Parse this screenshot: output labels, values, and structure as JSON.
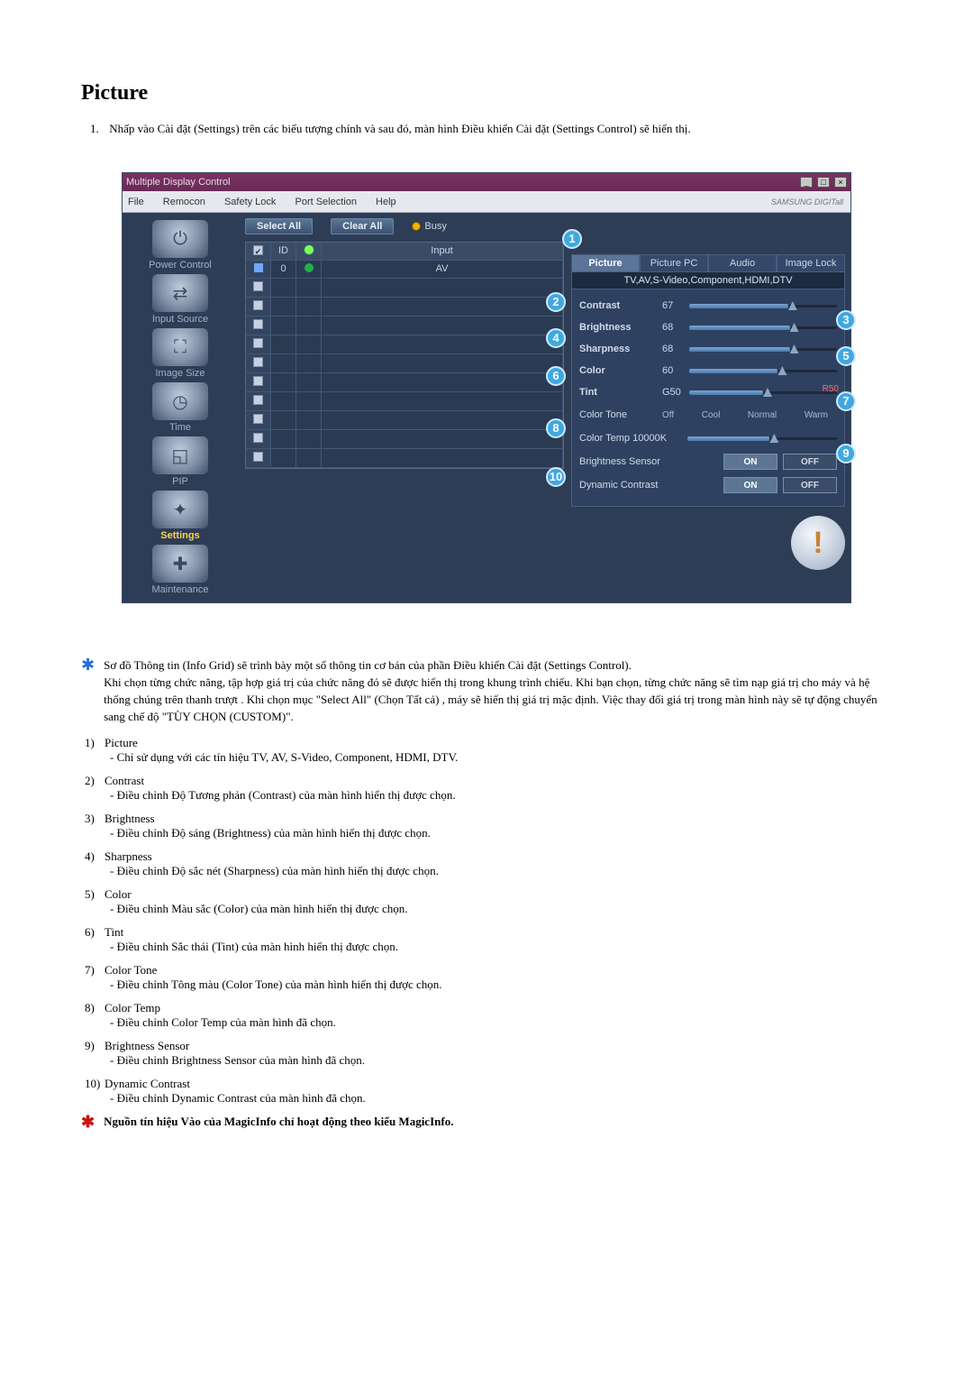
{
  "doc": {
    "title": "Picture",
    "intro_num": "1.",
    "intro": "Nhấp vào Cài đặt (Settings) trên các biểu tượng chính và sau đó, màn hình Điều khiển Cài đặt (Settings Control) sẽ hiển thị."
  },
  "app": {
    "window_title": "Multiple Display Control",
    "brand": "SAMSUNG DIGITall",
    "menus": [
      "File",
      "Remocon",
      "Safety Lock",
      "Port Selection",
      "Help"
    ],
    "win_buttons": [
      "_",
      "□",
      "×"
    ],
    "sidebar": [
      {
        "label": "Power Control",
        "glyph": "⏻"
      },
      {
        "label": "Input Source",
        "glyph": "⇄"
      },
      {
        "label": "Image Size",
        "glyph": "⛶"
      },
      {
        "label": "Time",
        "glyph": "◷"
      },
      {
        "label": "PIP",
        "glyph": "◱"
      },
      {
        "label": "Settings",
        "glyph": "✦",
        "active": true
      },
      {
        "label": "Maintenance",
        "glyph": "✚"
      }
    ],
    "buttons": {
      "select_all": "Select All",
      "clear_all": "Clear All",
      "busy": "Busy"
    },
    "grid": {
      "headers": [
        "",
        "ID",
        "",
        "Input"
      ],
      "row": {
        "id": "0",
        "input": "AV"
      }
    },
    "tabs": [
      "Picture",
      "Picture PC",
      "Audio",
      "Image Lock"
    ],
    "source_line": "TV,AV,S-Video,Component,HDMI,DTV",
    "params": [
      {
        "label": "Contrast",
        "value": "67",
        "pct": 67
      },
      {
        "label": "Brightness",
        "value": "68",
        "pct": 68
      },
      {
        "label": "Sharpness",
        "value": "68",
        "pct": 68
      },
      {
        "label": "Color",
        "value": "60",
        "pct": 60
      },
      {
        "label": "Tint",
        "value": "G50",
        "pct": 50,
        "right": "R50"
      }
    ],
    "color_tone": {
      "label": "Color Tone",
      "opts": [
        "Off",
        "Cool",
        "Normal",
        "Warm"
      ]
    },
    "color_temp": {
      "label": "Color Temp",
      "value": "10000K"
    },
    "brightness_sensor": {
      "label": "Brightness Sensor",
      "on": "ON",
      "off": "OFF"
    },
    "dynamic_contrast": {
      "label": "Dynamic Contrast",
      "on": "ON",
      "off": "OFF"
    },
    "callouts": [
      "1",
      "2",
      "3",
      "4",
      "5",
      "6",
      "7",
      "8",
      "9",
      "10"
    ]
  },
  "info_note": "Sơ đồ Thông tin (Info Grid) sẽ trình bày một số thông tin cơ bản của phần Điều khiển Cài đặt (Settings Control).\nKhi chọn từng chức năng, tập hợp giá trị của chức năng đó sẽ được hiển thị trong khung trình chiếu. Khi bạn chọn, từng chức năng sẽ tìm nạp giá trị cho máy và hệ thống chúng trên thanh trượt . Khi chọn mục \"Select All\" (Chọn Tất cả) , máy sẽ hiển thị giá trị mặc định. Việc thay đổi giá trị trong màn hình này sẽ tự động chuyển sang chế độ \"TÙY CHỌN (CUSTOM)\".",
  "defs": [
    {
      "n": "1)",
      "t": "Picture",
      "b": "- Chỉ sử dụng với các tín hiệu TV, AV, S-Video, Component, HDMI, DTV."
    },
    {
      "n": "2)",
      "t": "Contrast",
      "b": "- Điều chỉnh Độ Tương phản (Contrast) của màn hình hiển thị được chọn."
    },
    {
      "n": "3)",
      "t": "Brightness",
      "b": "- Điều chỉnh Độ sáng (Brightness) của màn hình hiển thị được chọn."
    },
    {
      "n": "4)",
      "t": "Sharpness",
      "b": "- Điều chỉnh Độ sắc nét (Sharpness) của màn hình hiển thị được chọn."
    },
    {
      "n": "5)",
      "t": "Color",
      "b": "- Điều chỉnh Màu sắc (Color) của màn hình hiển thị được chọn."
    },
    {
      "n": "6)",
      "t": "Tint",
      "b": "- Điều chỉnh Sắc thái (Tint) của màn hình hiển thị được chọn."
    },
    {
      "n": "7)",
      "t": "Color Tone",
      "b": "- Điều chỉnh Tông màu (Color Tone) của màn hình hiển thị được chọn."
    },
    {
      "n": "8)",
      "t": "Color Temp",
      "b": "- Điều chỉnh Color Temp của màn hình đã chọn."
    },
    {
      "n": "9)",
      "t": "Brightness Sensor",
      "b": "- Điều chỉnh Brightness Sensor của màn hình đã chọn."
    },
    {
      "n": "10)",
      "t": "Dynamic Contrast",
      "b": "- Điều chỉnh Dynamic Contrast của màn hình đã chọn."
    }
  ],
  "final_note": "Nguồn tín hiệu Vào của MagicInfo chỉ hoạt động theo kiểu MagicInfo."
}
